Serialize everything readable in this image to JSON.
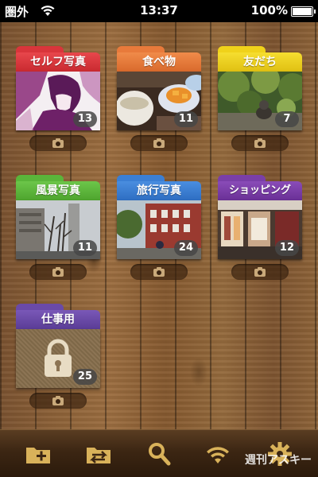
{
  "status": {
    "carrier": "圏外",
    "time": "13:37",
    "battery": "100%"
  },
  "albums": [
    {
      "name": "セルフ写真",
      "count": "13",
      "color": "#d9353b"
    },
    {
      "name": "食べ物",
      "count": "11",
      "color": "#e87a3b"
    },
    {
      "name": "友だち",
      "count": "7",
      "color": "#f0d21a"
    },
    {
      "name": "風景写真",
      "count": "11",
      "color": "#5ab53a"
    },
    {
      "name": "旅行写真",
      "count": "24",
      "color": "#3b7fd4"
    },
    {
      "name": "ショッピング",
      "count": "12",
      "color": "#7a3fa8"
    },
    {
      "name": "仕事用",
      "count": "25",
      "color": "#6a4aa8"
    }
  ],
  "toolbar": {
    "icons": [
      "add-folder-icon",
      "move-folder-icon",
      "search-icon",
      "wifi-icon",
      "settings-gear-icon"
    ]
  },
  "watermark": "週刊アスキー"
}
